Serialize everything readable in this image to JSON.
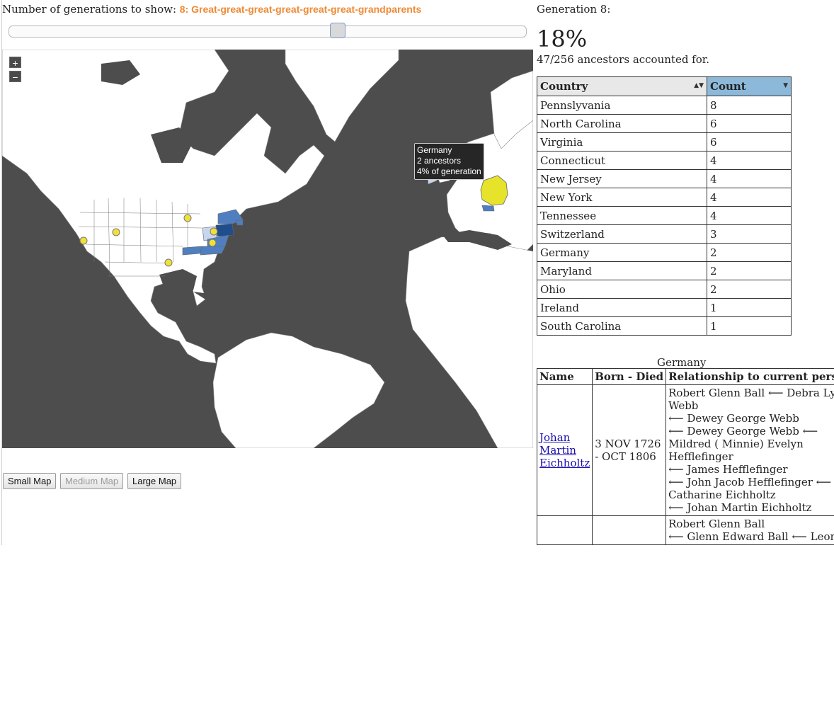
{
  "generation_selector": {
    "label": "Number of generations to show:",
    "value": "8: Great-great-great-great-great-great-grandparents",
    "slider_level": 0.64
  },
  "map": {
    "zoom_in_label": "+",
    "zoom_out_label": "−",
    "tooltip": {
      "country": "Germany",
      "ancestors": "2 ancestors",
      "percent": "4% of generation"
    },
    "colors": {
      "ocean": "#4d4d4d",
      "land": "#ffffff",
      "highlight": "#e6e32a",
      "shade_dark": "#1f4e8c",
      "shade_mid": "#4f7fc0",
      "shade_light": "#c7d6ee",
      "point": "#f2df3a"
    }
  },
  "buttons": {
    "small": "Small Map",
    "medium": "Medium Map",
    "large": "Large Map"
  },
  "stats": {
    "generation_label": "Generation 8:",
    "percent": "18%",
    "accounted": "47/256 ancestors accounted for."
  },
  "country_table": {
    "headers": [
      "Country",
      "Count"
    ],
    "rows": [
      [
        "Pennslyvania",
        "8"
      ],
      [
        "North Carolina",
        "6"
      ],
      [
        "Virginia",
        "6"
      ],
      [
        "Connecticut",
        "4"
      ],
      [
        "New Jersey",
        "4"
      ],
      [
        "New York",
        "4"
      ],
      [
        "Tennessee",
        "4"
      ],
      [
        "Switzerland",
        "3"
      ],
      [
        "Germany",
        "2"
      ],
      [
        "Maryland",
        "2"
      ],
      [
        "Ohio",
        "2"
      ],
      [
        "Ireland",
        "1"
      ],
      [
        "South Carolina",
        "1"
      ]
    ]
  },
  "detail": {
    "title": "Germany",
    "headers": [
      "Name",
      "Born - Died",
      "Relationship to current person"
    ],
    "rows": [
      {
        "name": "Johan Martin Eichholtz",
        "dates": "3 NOV 1726 - OCT 1806",
        "relationship": [
          "Robert Glenn Ball ⟵ Debra Lynn Webb",
          "⟵ Dewey George Webb",
          "⟵ Dewey George Webb ⟵ Mildred ( Minnie) Evelyn Hefflefinger",
          "⟵ James Hefflefinger",
          "⟵ John Jacob Hefflefinger ⟵ Catharine Eichholtz",
          "⟵ Johan Martin Eichholtz"
        ]
      },
      {
        "name": "",
        "dates": "",
        "relationship": [
          "Robert Glenn Ball",
          "⟵ Glenn Edward Ball ⟵ Leona"
        ]
      }
    ]
  }
}
